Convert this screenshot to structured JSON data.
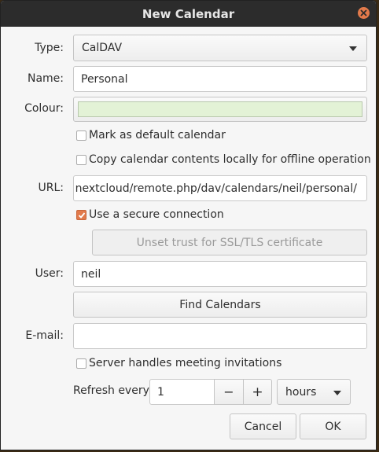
{
  "window": {
    "title": "New Calendar"
  },
  "form": {
    "type_label": "Type:",
    "type_value": "CalDAV",
    "name_label": "Name:",
    "name_value": "Personal",
    "colour_label": "Colour:",
    "colour_value": "#e3f2d6",
    "default_calendar_label": "Mark as default calendar",
    "default_calendar_checked": false,
    "offline_copy_label": "Copy calendar contents locally for offline operation",
    "offline_copy_checked": false,
    "url_label": "URL:",
    "url_value": "nextcloud/remote.php/dav/calendars/neil/personal/",
    "secure_label": "Use a secure connection",
    "secure_checked": true,
    "unset_trust_label": "Unset trust for SSL/TLS certificate",
    "user_label": "User:",
    "user_value": "neil",
    "find_calendars_label": "Find Calendars",
    "email_label": "E-mail:",
    "email_value": "",
    "server_invites_label": "Server handles meeting invitations",
    "server_invites_checked": false,
    "refresh_label": "Refresh every",
    "refresh_value": "1",
    "minus_symbol": "−",
    "plus_symbol": "+",
    "refresh_unit": "hours"
  },
  "buttons": {
    "cancel": "Cancel",
    "ok": "OK"
  },
  "colors": {
    "accent": "#e27a4b",
    "titlebar": "#2c2c2c"
  }
}
